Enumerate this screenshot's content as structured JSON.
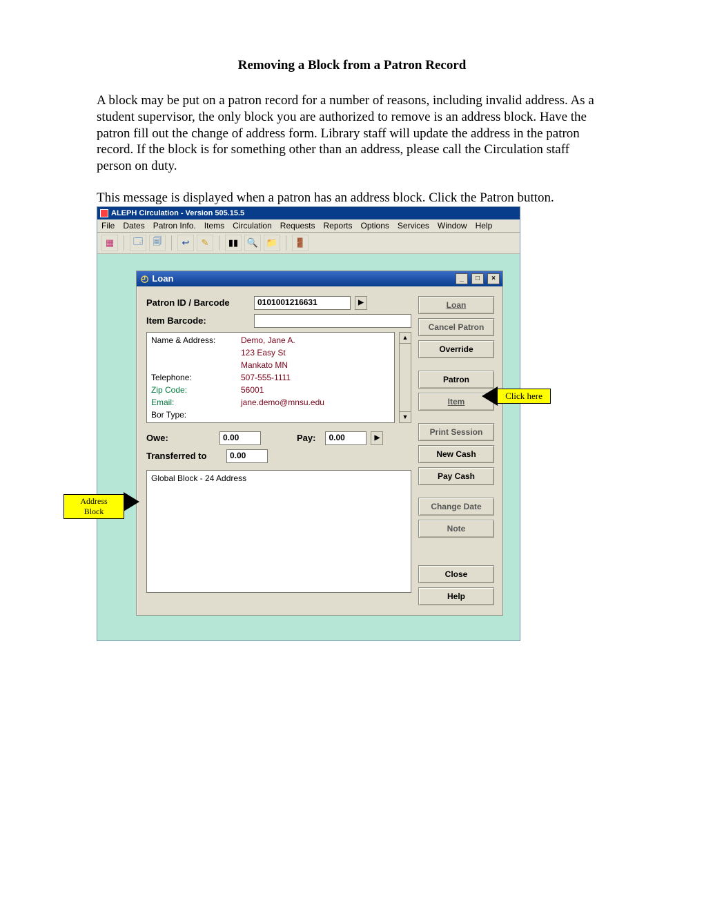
{
  "doc": {
    "title": "Removing a Block from a Patron Record",
    "para1": "A block may be put on a patron record for a number of reasons, including invalid address. As a student supervisor, the only block you are authorized to remove is an address block. Have the patron fill out the change of address form.  Library staff will update the address in the patron record.  If the block is for something other than an address, please call the Circulation staff person on duty.",
    "para2": "This message is displayed when a patron has an address block. Click the Patron button."
  },
  "app": {
    "title": "ALEPH Circulation - Version 505.15.5",
    "menus": [
      "File",
      "Dates",
      "Patron Info.",
      "Items",
      "Circulation",
      "Requests",
      "Reports",
      "Options",
      "Services",
      "Window",
      "Help"
    ]
  },
  "dialog": {
    "title": "Loan",
    "patron_id_label": "Patron ID / Barcode",
    "patron_id_value": "0101001216631",
    "item_barcode_label": "Item Barcode:",
    "item_barcode_value": "",
    "info": {
      "name_label": "Name & Address:",
      "name": "Demo, Jane A.",
      "addr1": "123 Easy St",
      "addr2": "Mankato MN",
      "tel_label": "Telephone:",
      "tel": "507-555-1111",
      "zip_label": "Zip Code:",
      "zip": "56001",
      "email_label": "Email:",
      "email": "jane.demo@mnsu.edu",
      "bor_label": "Bor Type:"
    },
    "owe_label": "Owe:",
    "owe_value": "0.00",
    "pay_label": "Pay:",
    "pay_value": "0.00",
    "transferred_label": "Transferred to",
    "transferred_value": "0.00",
    "block_text": "Global Block - 24 Address",
    "buttons": {
      "loan": "Loan",
      "cancel_patron": "Cancel Patron",
      "override": "Override",
      "patron": "Patron",
      "item": "Item",
      "print_session": "Print Session",
      "new_cash": "New Cash",
      "pay_cash": "Pay Cash",
      "change_date": "Change Date",
      "note": "Note",
      "close": "Close",
      "help": "Help"
    }
  },
  "callouts": {
    "click_here": "Click here",
    "address_block": "Address Block"
  }
}
